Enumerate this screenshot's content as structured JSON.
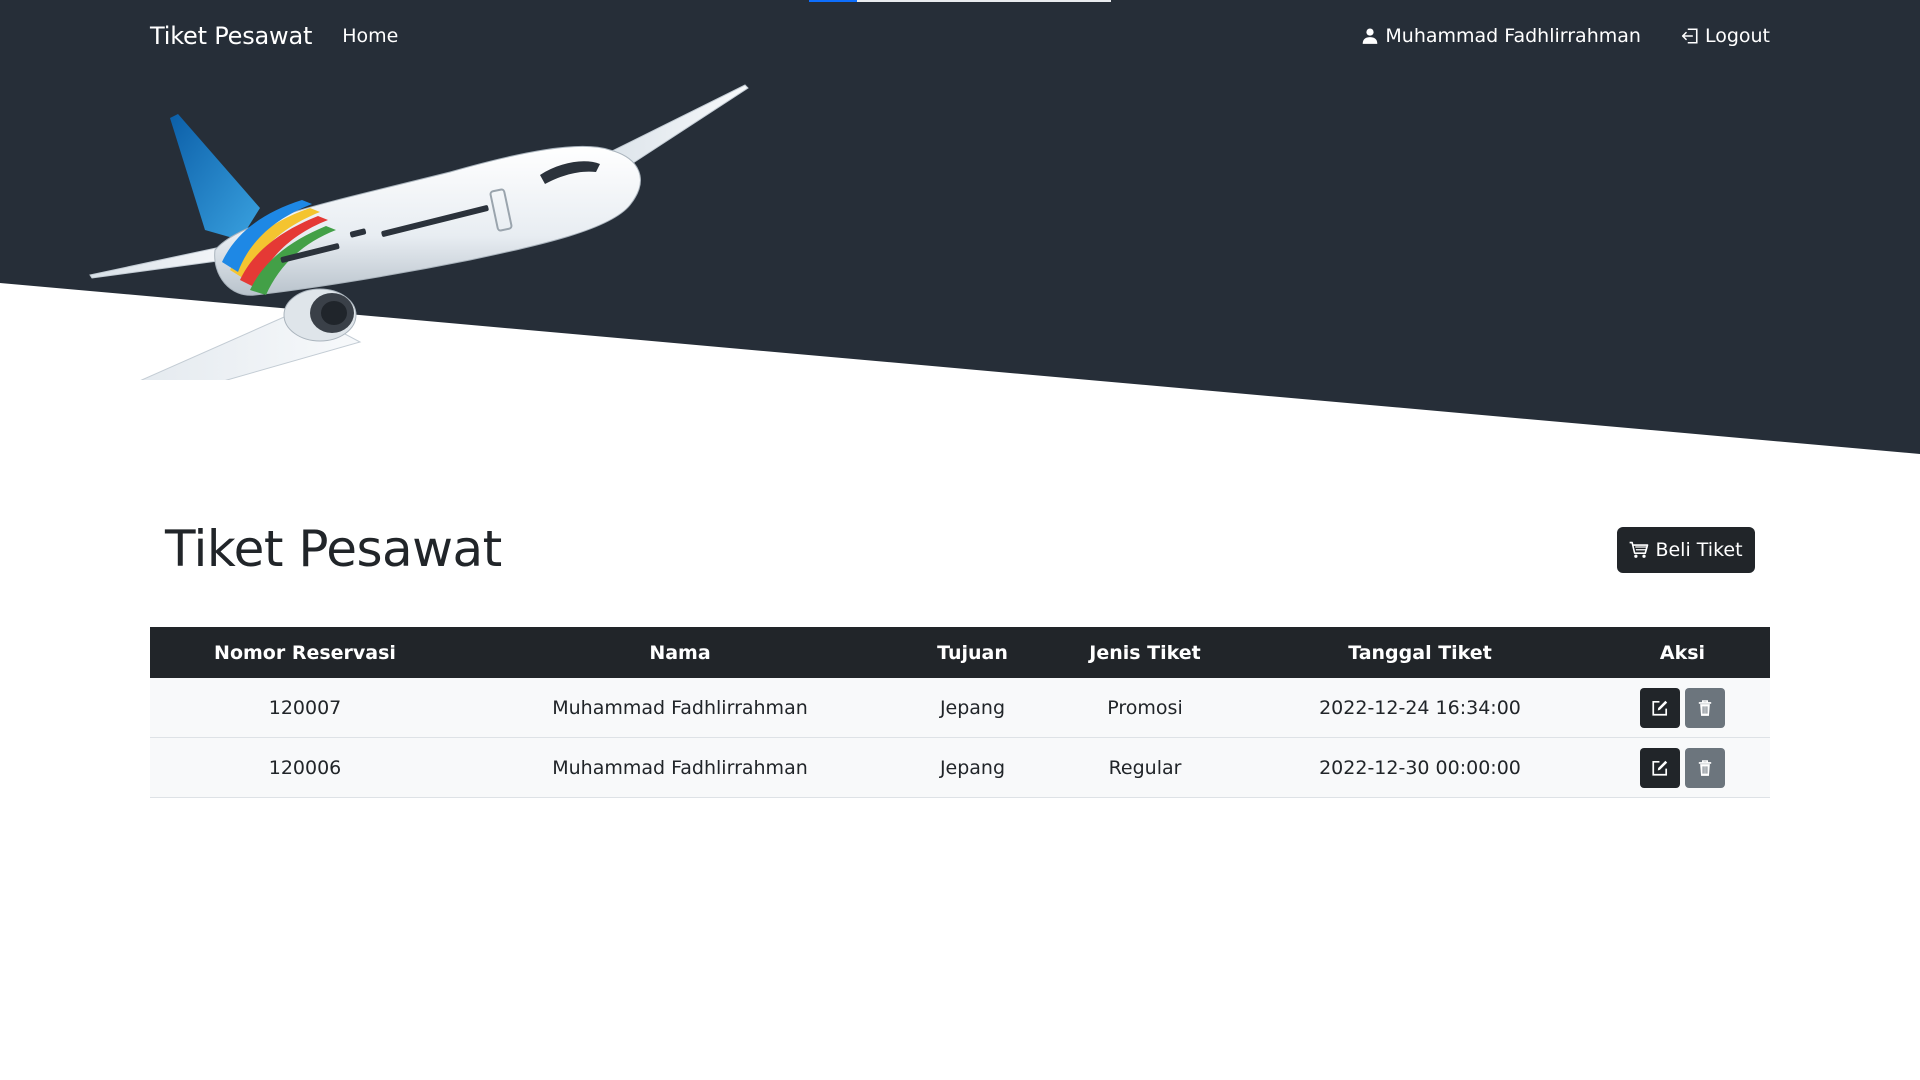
{
  "navbar": {
    "brand": "Tiket Pesawat",
    "home": "Home",
    "user": "Muhammad Fadhlirrahman",
    "logout": "Logout"
  },
  "page": {
    "title": "Tiket Pesawat",
    "buy_button": "Beli Tiket"
  },
  "table": {
    "headers": [
      "Nomor Reservasi",
      "Nama",
      "Tujuan",
      "Jenis Tiket",
      "Tanggal Tiket",
      "Aksi"
    ],
    "rows": [
      [
        "120007",
        "Muhammad Fadhlirrahman",
        "Jepang",
        "Promosi",
        "2022-12-24 16:34:00"
      ],
      [
        "120006",
        "Muhammad Fadhlirrahman",
        "Jepang",
        "Regular",
        "2022-12-30 00:00:00"
      ]
    ]
  },
  "icons": {
    "user": "person-icon",
    "logout": "logout-icon",
    "cart": "cart-icon",
    "edit": "edit-icon",
    "delete": "trash-icon",
    "plane": "airplane-illustration"
  },
  "colors": {
    "hero": "#262e38",
    "dark": "#212529",
    "secondary": "#6c757d",
    "progress": "#0d6efd"
  },
  "page_loading_progress": 0.16
}
